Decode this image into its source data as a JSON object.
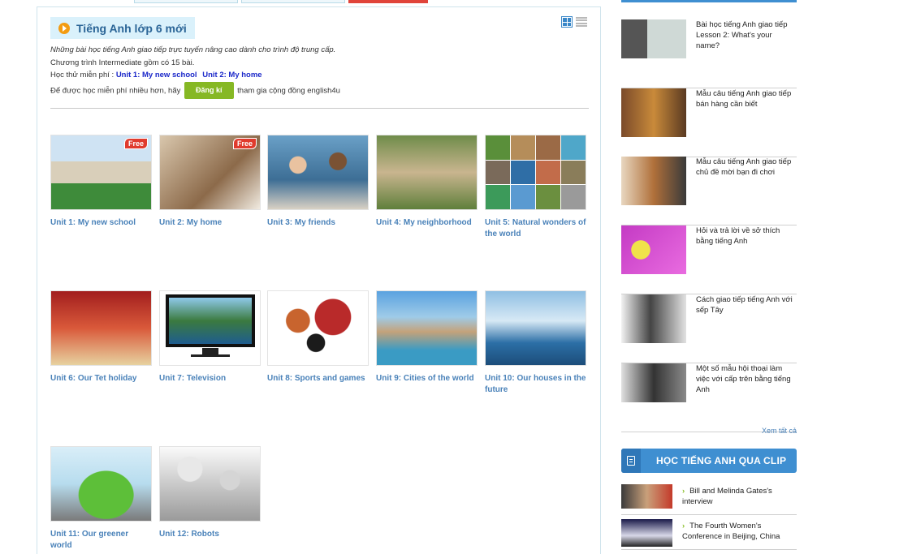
{
  "main": {
    "title": "Tiếng Anh lớp 6 mới",
    "intro_line1": "Những bài học tiếng Anh giao tiếp trực tuyến nâng cao dành cho trình độ trung cấp.",
    "intro_line2": "Chương trình Intermediate gồm có 15 bài.",
    "trial_label": "Học thử miễn phí :",
    "trial_links": [
      "Unit 1: My new school",
      "Unit 2: My home"
    ],
    "more_prefix": "Để được học miễn phí nhiều hơn, hãy",
    "register_label": "Đăng kí",
    "more_suffix": "tham gia cộng đồng english4u",
    "free_badge": "Free",
    "units": [
      {
        "caption": "Unit 1: My new school",
        "free": true
      },
      {
        "caption": "Unit 2: My home",
        "free": true
      },
      {
        "caption": "Unit 3: My friends",
        "free": false
      },
      {
        "caption": "Unit 4: My neighborhood",
        "free": false
      },
      {
        "caption": "Unit 5: Natural wonders of the world",
        "free": false
      },
      {
        "caption": "Unit 6: Our Tet holiday",
        "free": false
      },
      {
        "caption": "Unit 7: Television",
        "free": false
      },
      {
        "caption": "Unit 8: Sports and games",
        "free": false
      },
      {
        "caption": "Unit 9: Cities of the world",
        "free": false
      },
      {
        "caption": "Unit 10: Our houses in the future",
        "free": false
      },
      {
        "caption": "Unit 11: Our greener world",
        "free": false
      },
      {
        "caption": "Unit 12: Robots",
        "free": false
      }
    ]
  },
  "sidebar": {
    "articles": [
      {
        "title": "Bài học tiếng Anh giao tiếp Lesson 2: What's your name?"
      },
      {
        "title": "Mẫu câu tiếng Anh giao tiếp bán hàng cần biết"
      },
      {
        "title": "Mẫu câu tiếng Anh giao tiếp chủ đề mời bạn đi chơi"
      },
      {
        "title": "Hỏi và trả lời về sở thích bằng tiếng Anh"
      },
      {
        "title": "Cách giao tiếp tiếng Anh với sếp Tây"
      },
      {
        "title": "Một số mẫu hội thoại làm việc với cấp trên bằng tiếng Anh"
      }
    ],
    "see_all": "Xem tất cả",
    "clip_heading": "HỌC TIẾNG ANH QUA CLIP",
    "clips": [
      {
        "title": "Bill and Melinda Gates's interview"
      },
      {
        "title": "The Fourth Women's Conference in Beijing, China"
      }
    ]
  },
  "colors": {
    "link_blue": "#4a82b9",
    "accent_blue": "#3f8fd1",
    "register_green": "#86b824",
    "free_red": "#e03b2d"
  },
  "icons": [
    "play-circle-icon",
    "grid-view-icon",
    "list-view-icon",
    "clip-document-icon",
    "chevron-right-icon"
  ]
}
